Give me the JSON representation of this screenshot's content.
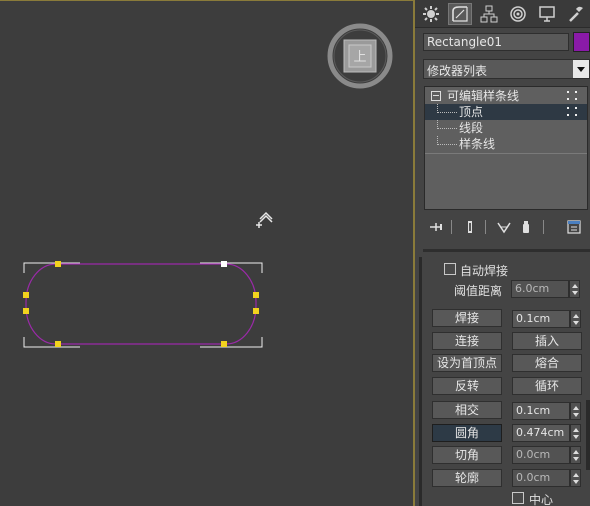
{
  "object_name": "Rectangle01",
  "object_color": "#8a1aa8",
  "modifier_list": {
    "label": "修改器列表"
  },
  "stack": {
    "root": "可编辑样条线",
    "items": [
      "顶点",
      "线段",
      "样条线"
    ]
  },
  "command_tabs": [
    "create-icon",
    "modify-icon",
    "hierarchy-icon",
    "motion-icon",
    "display-icon",
    "utilities-icon"
  ],
  "stack_tools": [
    "pin-stack-icon",
    "show-end-result-icon",
    "make-unique-icon",
    "remove-modifier-icon",
    "configure-sets-icon"
  ],
  "geometry": {
    "auto_weld": "自动焊接",
    "threshold_label": "阈值距离",
    "threshold_value": "6.0cm",
    "weld_label": "焊接",
    "weld_value": "0.1cm",
    "connect_label": "连接",
    "insert_label": "插入",
    "make_first_label": "设为首顶点",
    "fuse_label": "熔合",
    "reverse_label": "反转",
    "cycle_label": "循环",
    "cross_insert_label": "相交",
    "cross_insert_value": "0.1cm",
    "fillet_label": "圆角",
    "fillet_value": "0.474cm",
    "chamfer_label": "切角",
    "chamfer_value": "0.0cm",
    "outline_label": "轮廓",
    "outline_value": "0.0cm",
    "center_label": "中心"
  },
  "viewport": {
    "viewcube_face": "上",
    "shape_color": "#8a1aa8",
    "vertex_color": "#f2d21e"
  }
}
